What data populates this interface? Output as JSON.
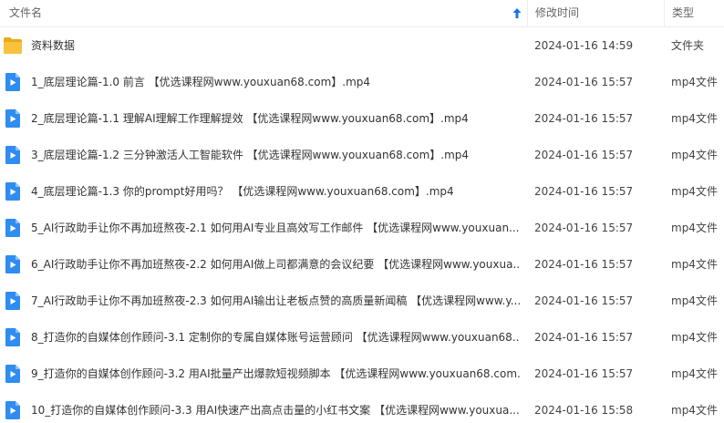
{
  "header": {
    "name_label": "文件名",
    "date_label": "修改时间",
    "type_label": "类型"
  },
  "colors": {
    "folder": "#f9c23c",
    "video": "#2f8cf0",
    "accent": "#1a73e8"
  },
  "rows": [
    {
      "icon": "folder-icon",
      "name": "资料数据",
      "date": "2024-01-16 14:59",
      "type": "文件夹"
    },
    {
      "icon": "video-file-icon",
      "name": "1_底层理论篇-1.0 前言 【优选课程网www.youxuan68.com】.mp4",
      "date": "2024-01-16 15:57",
      "type": "mp4文件"
    },
    {
      "icon": "video-file-icon",
      "name": "2_底层理论篇-1.1 理解AI理解工作理解提效 【优选课程网www.youxuan68.com】.mp4",
      "date": "2024-01-16 15:57",
      "type": "mp4文件"
    },
    {
      "icon": "video-file-icon",
      "name": "3_底层理论篇-1.2 三分钟激活人工智能软件 【优选课程网www.youxuan68.com】.mp4",
      "date": "2024-01-16 15:57",
      "type": "mp4文件"
    },
    {
      "icon": "video-file-icon",
      "name": "4_底层理论篇-1.3 你的prompt好用吗？ 【优选课程网www.youxuan68.com】.mp4",
      "date": "2024-01-16 15:57",
      "type": "mp4文件"
    },
    {
      "icon": "video-file-icon",
      "name": "5_AI行政助手让你不再加班熬夜-2.1 如何用AI专业且高效写工作邮件 【优选课程网www.youxuan...",
      "date": "2024-01-16 15:57",
      "type": "mp4文件"
    },
    {
      "icon": "video-file-icon",
      "name": "6_AI行政助手让你不再加班熬夜-2.2 如何用AI做上司都满意的会议纪要 【优选课程网www.youxua...",
      "date": "2024-01-16 15:57",
      "type": "mp4文件"
    },
    {
      "icon": "video-file-icon",
      "name": "7_AI行政助手让你不再加班熬夜-2.3 如何用AI输出让老板点赞的高质量新闻稿 【优选课程网www.y...",
      "date": "2024-01-16 15:57",
      "type": "mp4文件"
    },
    {
      "icon": "video-file-icon",
      "name": "8_打造你的自媒体创作顾问-3.1 定制你的专属自媒体账号运营顾问 【优选课程网www.youxuan68....",
      "date": "2024-01-16 15:57",
      "type": "mp4文件"
    },
    {
      "icon": "video-file-icon",
      "name": "9_打造你的自媒体创作顾问-3.2 用AI批量产出爆款短视频脚本 【优选课程网www.youxuan68.com...",
      "date": "2024-01-16 15:57",
      "type": "mp4文件"
    },
    {
      "icon": "video-file-icon",
      "name": "10_打造你的自媒体创作顾问-3.3 用AI快速产出高点击量的小红书文案 【优选课程网www.youxua...",
      "date": "2024-01-16 15:58",
      "type": "mp4文件"
    }
  ]
}
